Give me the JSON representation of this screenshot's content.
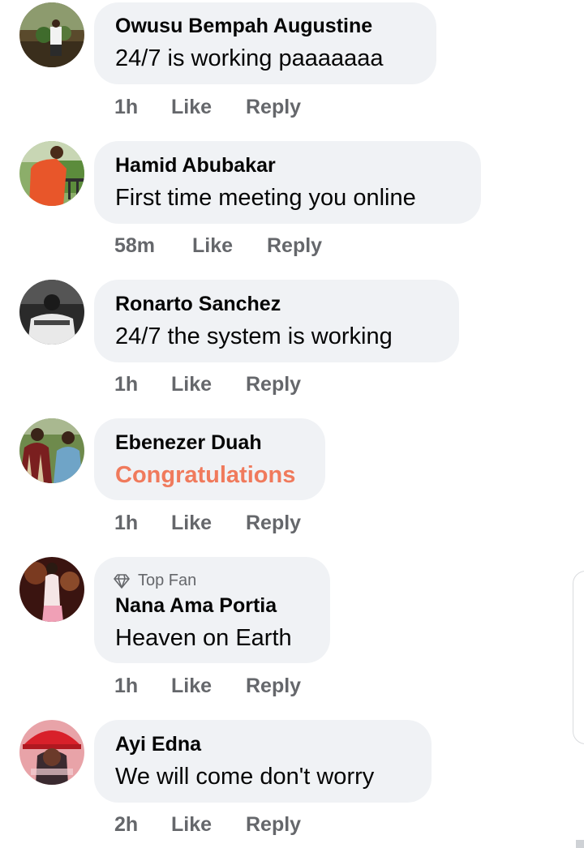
{
  "comments": [
    {
      "name": "Owusu Bempah Augustine",
      "text": "24/7 is working paaaaaaa",
      "time": "1h",
      "like": "Like",
      "reply": "Reply"
    },
    {
      "name": "Hamid Abubakar",
      "text": "First time meeting you online",
      "time": "58m",
      "like": "Like",
      "reply": "Reply"
    },
    {
      "name": "Ronarto Sanchez",
      "text": "24/7 the system is working",
      "time": "1h",
      "like": "Like",
      "reply": "Reply"
    },
    {
      "name": "Ebenezer Duah",
      "text": "Congratulations",
      "time": "1h",
      "like": "Like",
      "reply": "Reply"
    },
    {
      "badge": "Top Fan",
      "name": "Nana Ama Portia",
      "text": "Heaven on Earth",
      "time": "1h",
      "like": "Like",
      "reply": "Reply"
    },
    {
      "name": "Ayi Edna",
      "text": "We will come don't worry",
      "time": "2h",
      "like": "Like",
      "reply": "Reply"
    }
  ],
  "colors": {
    "bubble": "#f0f2f5",
    "name_text": "#050505",
    "meta_text": "#65676b",
    "highlight_text": "#f07a5c"
  },
  "icons": {
    "badge": "diamond-icon"
  }
}
